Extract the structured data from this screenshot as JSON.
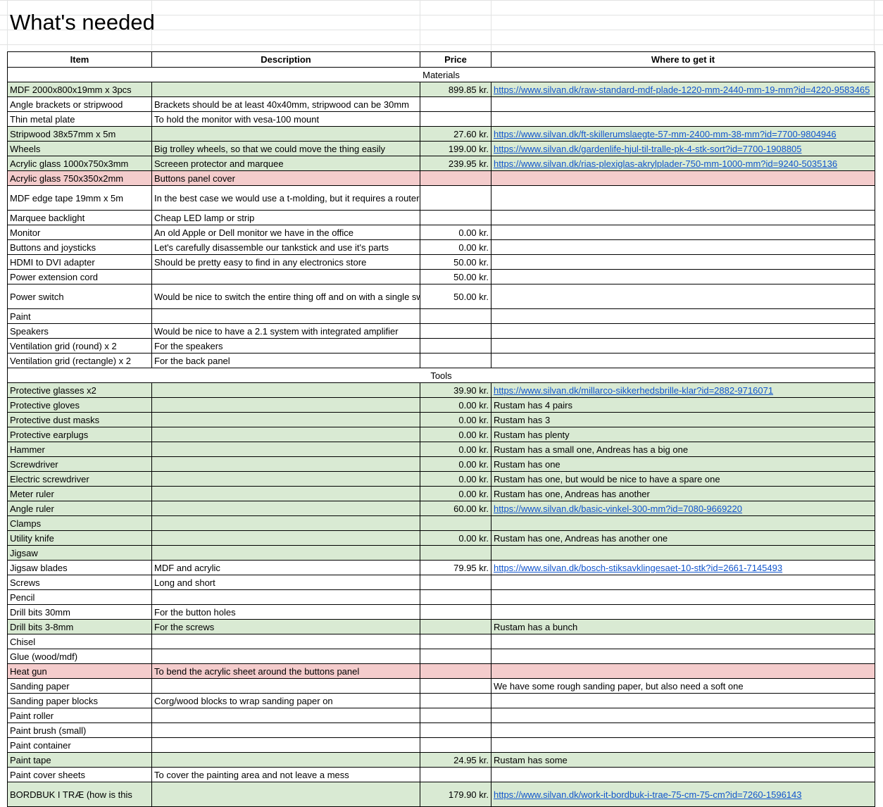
{
  "title": "What's needed",
  "headers": {
    "item": "Item",
    "description": "Description",
    "price": "Price",
    "where": "Where to get it"
  },
  "colors": {
    "green": "#d9ead3",
    "red": "#f4cccc",
    "link": "#1155cc"
  },
  "rows": [
    {
      "section": "Materials"
    },
    {
      "item": "MDF 2000x800x19mm x 3pcs",
      "description": "",
      "price": "899.85 kr.",
      "where": "https://www.silvan.dk/raw-standard-mdf-plade-1220-mm-2440-mm-19-mm?id=4220-9583465",
      "link": true,
      "color": "green"
    },
    {
      "item": "Angle brackets or stripwood",
      "description": "Brackets should be at least 40x40mm, stripwood can be 30mm",
      "price": "",
      "where": ""
    },
    {
      "item": "Thin metal plate",
      "description": "To hold the monitor with vesa-100 mount",
      "price": "",
      "where": ""
    },
    {
      "item": "Stripwood 38x57mm x 5m",
      "description": "",
      "price": "27.60 kr.",
      "where": "https://www.silvan.dk/ft-skillerumslaegte-57-mm-2400-mm-38-mm?id=7700-9804946",
      "link": true,
      "color": "green"
    },
    {
      "item": "Wheels",
      "description": "Big trolley wheels, so that we could move the thing easily",
      "price": "199.00 kr.",
      "where": "https://www.silvan.dk/gardenlife-hjul-til-tralle-pk-4-stk-sort?id=7700-1908805",
      "link": true,
      "color": "green"
    },
    {
      "item": "Acrylic glass 1000x750x3mm",
      "description": "Screeen protector and marquee",
      "price": "239.95 kr.",
      "where": "https://www.silvan.dk/rias-plexiglas-akrylplader-750-mm-1000-mm?id=9240-5035136",
      "link": true,
      "color": "green"
    },
    {
      "item": "Acrylic glass 750x350x2mm",
      "description": "Buttons panel cover",
      "price": "",
      "where": "",
      "color": "red"
    },
    {
      "item": "MDF edge tape 19mm x 5m",
      "description": "In the best case we would use a t-molding, but it requires a router tool with a proper bit, both a pretty hard to find",
      "price": "",
      "where": "",
      "tall": true
    },
    {
      "item": "Marquee backlight",
      "description": "Cheap LED lamp or strip",
      "price": "",
      "where": ""
    },
    {
      "item": "Monitor",
      "description": "An old Apple or Dell monitor we have in the office",
      "price": "0.00 kr.",
      "where": ""
    },
    {
      "item": "Buttons and joysticks",
      "description": "Let's carefully disassemble our tankstick and use it's parts",
      "price": "0.00 kr.",
      "where": ""
    },
    {
      "item": "HDMI to DVI adapter",
      "description": "Should be pretty easy to find in any electronics store",
      "price": "50.00 kr.",
      "where": ""
    },
    {
      "item": "Power extension cord",
      "description": "",
      "price": "50.00 kr.",
      "where": ""
    },
    {
      "item": "Power switch",
      "description": "Would be nice to switch the entire thing off and on with a single switch on the back panel",
      "price": "50.00 kr.",
      "where": "",
      "tall": true
    },
    {
      "item": "Paint",
      "description": "",
      "price": "",
      "where": ""
    },
    {
      "item": "Speakers",
      "description": "Would be nice to have a 2.1 system with integrated amplifier",
      "price": "",
      "where": ""
    },
    {
      "item": "Ventilation grid (round) x 2",
      "description": "For the speakers",
      "price": "",
      "where": ""
    },
    {
      "item": "Ventilation grid (rectangle) x 2",
      "description": "For the back panel",
      "price": "",
      "where": ""
    },
    {
      "section": "Tools"
    },
    {
      "item": "Protective glasses x2",
      "description": "",
      "price": "39.90 kr.",
      "where": "https://www.silvan.dk/millarco-sikkerhedsbrille-klar?id=2882-9716071",
      "link": true,
      "color": "green"
    },
    {
      "item": "Protective gloves",
      "description": "",
      "price": "0.00 kr.",
      "where": "Rustam has 4 pairs",
      "color": "green"
    },
    {
      "item": "Protective dust masks",
      "description": "",
      "price": "0.00 kr.",
      "where": "Rustam has 3",
      "color": "green"
    },
    {
      "item": "Protective earplugs",
      "description": "",
      "price": "0.00 kr.",
      "where": "Rustam has plenty",
      "color": "green"
    },
    {
      "item": "Hammer",
      "description": "",
      "price": "0.00 kr.",
      "where": "Rustam has a small one, Andreas has a big one",
      "color": "green"
    },
    {
      "item": "Screwdriver",
      "description": "",
      "price": "0.00 kr.",
      "where": "Rustam has one",
      "color": "green"
    },
    {
      "item": "Electric screwdriver",
      "description": "",
      "price": "0.00 kr.",
      "where": "Rustam has one, but would be nice to have a spare one",
      "color": "green"
    },
    {
      "item": "Meter ruler",
      "description": "",
      "price": "0.00 kr.",
      "where": "Rustam has one, Andreas has another",
      "color": "green"
    },
    {
      "item": "Angle ruler",
      "description": "",
      "price": "60.00 kr.",
      "where": "https://www.silvan.dk/basic-vinkel-300-mm?id=7080-9669220",
      "link": true,
      "color": "green"
    },
    {
      "item": "Clamps",
      "description": "",
      "price": "",
      "where": "",
      "color": "green"
    },
    {
      "item": "Utility knife",
      "description": "",
      "price": "0.00 kr.",
      "where": "Rustam has one, Andreas has another one",
      "color": "green"
    },
    {
      "item": "Jigsaw",
      "description": "",
      "price": "",
      "where": "",
      "color": "green"
    },
    {
      "item": "Jigsaw blades",
      "description": "MDF and acrylic",
      "price": "79.95 kr.",
      "where": "https://www.silvan.dk/bosch-stiksavklingesaet-10-stk?id=2661-7145493",
      "link": true
    },
    {
      "item": "Screws",
      "description": "Long and short",
      "price": "",
      "where": ""
    },
    {
      "item": "Pencil",
      "description": "",
      "price": "",
      "where": ""
    },
    {
      "item": "Drill bits 30mm",
      "description": "For the button holes",
      "price": "",
      "where": ""
    },
    {
      "item": "Drill bits 3-8mm",
      "description": "For the screws",
      "price": "",
      "where": "Rustam has a bunch",
      "color": "green"
    },
    {
      "item": "Chisel",
      "description": "",
      "price": "",
      "where": ""
    },
    {
      "item": "Glue (wood/mdf)",
      "description": "",
      "price": "",
      "where": ""
    },
    {
      "item": "Heat gun",
      "description": "To bend the acrylic sheet around the buttons panel",
      "price": "",
      "where": "",
      "color": "red"
    },
    {
      "item": "Sanding paper",
      "description": "",
      "price": "",
      "where": "We have some rough sanding paper, but also need a soft one"
    },
    {
      "item": "Sanding paper blocks",
      "description": "Corg/wood blocks to wrap sanding paper on",
      "price": "",
      "where": ""
    },
    {
      "item": "Paint roller",
      "description": "",
      "price": "",
      "where": ""
    },
    {
      "item": "Paint brush (small)",
      "description": "",
      "price": "",
      "where": ""
    },
    {
      "item": "Paint container",
      "description": "",
      "price": "",
      "where": ""
    },
    {
      "item": "Paint tape",
      "description": "",
      "price": "24.95 kr.",
      "where": "Rustam has some",
      "color": "green"
    },
    {
      "item": "Paint cover sheets",
      "description": "To cover the painting area and not leave a mess",
      "price": "",
      "where": ""
    },
    {
      "item": "BORDBUK I TRÆ (how is this",
      "description": "",
      "price": "179.90 kr.",
      "where": "https://www.silvan.dk/work-it-bordbuk-i-trae-75-cm-75-cm?id=7260-1596143",
      "link": true,
      "color": "green",
      "tall": true
    }
  ]
}
